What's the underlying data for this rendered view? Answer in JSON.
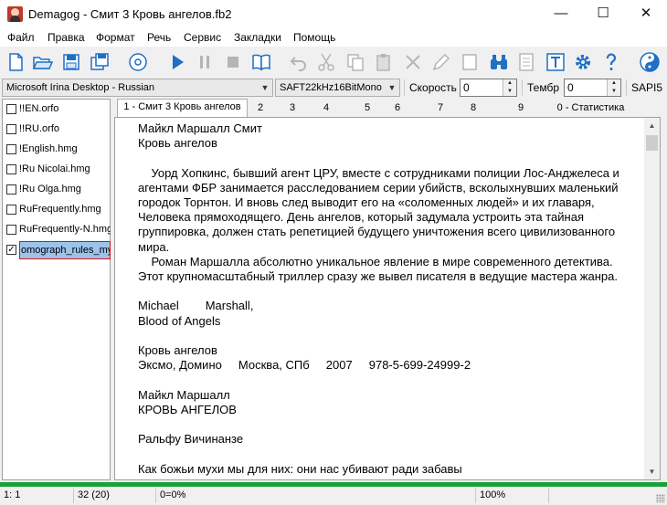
{
  "window": {
    "title": "Demagog - Смит 3 Кровь ангелов.fb2"
  },
  "window_controls": {
    "minimize": "—",
    "maximize": "☐",
    "close": "✕"
  },
  "menu": [
    "Файл",
    "Правка",
    "Формат",
    "Речь",
    "Сервис",
    "Закладки",
    "Помощь"
  ],
  "toolbar": {
    "icons": [
      "new-file-icon",
      "open-folder-icon",
      "save-icon",
      "save-all-icon",
      "read-cd-icon",
      "play-icon",
      "pause-icon",
      "stop-icon",
      "book-icon",
      "undo-icon",
      "cut-icon",
      "copy-icon",
      "paste-icon",
      "delete-icon",
      "edit-icon",
      "frame-icon",
      "binoculars-icon",
      "document-icon",
      "text-t-icon",
      "gear-icon",
      "help-icon",
      "yin-yang-icon"
    ]
  },
  "voice": {
    "engine": "Microsoft Irina Desktop - Russian",
    "format": "SAFT22kHz16BitMono",
    "speed_label": "Скорость",
    "speed_value": "0",
    "timbre_label": "Тембр",
    "timbre_value": "0",
    "api": "SAPI5"
  },
  "dictionaries": [
    {
      "label": "!!EN.orfo",
      "checked": false
    },
    {
      "label": "!!RU.orfo",
      "checked": false
    },
    {
      "label": "!English.hmg",
      "checked": false
    },
    {
      "label": "!Ru Nicolai.hmg",
      "checked": false
    },
    {
      "label": "!Ru Olga.hmg",
      "checked": false
    },
    {
      "label": "RuFrequently.hmg",
      "checked": false
    },
    {
      "label": "RuFrequently-N.hmg",
      "checked": false
    },
    {
      "label": "omograph_rules_myth",
      "checked": true
    }
  ],
  "tabs": [
    "1 - Смит 3 Кровь ангелов",
    "2",
    "3",
    "4",
    "5",
    "6",
    "7",
    "8",
    "9",
    "0 - Статистика"
  ],
  "editor": {
    "text": "Майкл Маршалл Смит\nКровь ангелов\n\n    Уорд Хопкинс, бывший агент ЦРУ, вместе с сотрудниками полиции Лос-Анджелеса и агентами ФБР занимается расследованием серии убийств, всколыхнувших маленький городок Торнтон. И вновь след выводит его на «соломенных людей» и их главаря, Человека прямоходящего. День ангелов, который задумала устроить эта тайная группировка, должен стать репетицией будущего уничтожения всего цивилизованного мира.\n    Роман Маршалла абсолютно уникальное явление в мире современного детектива. Этот крупномасштабный триллер сразу же вывел писателя в ведущие мастера жанра.\n\nMichael        Marshall,\nBlood of Angels\n\nКровь ангелов\nЭксмо, Домино     Москва, СПб     2007     978-5-699-24999-2\n\nМайкл Маршалл\nКРОВЬ АНГЕЛОВ\n\nРальфу Вичинанзе\n\nКак божьи мухи мы для них: они нас убивают ради забавы"
  },
  "progress_percent": 100,
  "status": {
    "position": "1: 1",
    "count": "32 (20)",
    "percent": "0=0%",
    "zoom": "100%"
  },
  "colors": {
    "accent_blue": "#1f6fc5",
    "progress_green": "#19a139",
    "selection": "#9cc3ea"
  }
}
